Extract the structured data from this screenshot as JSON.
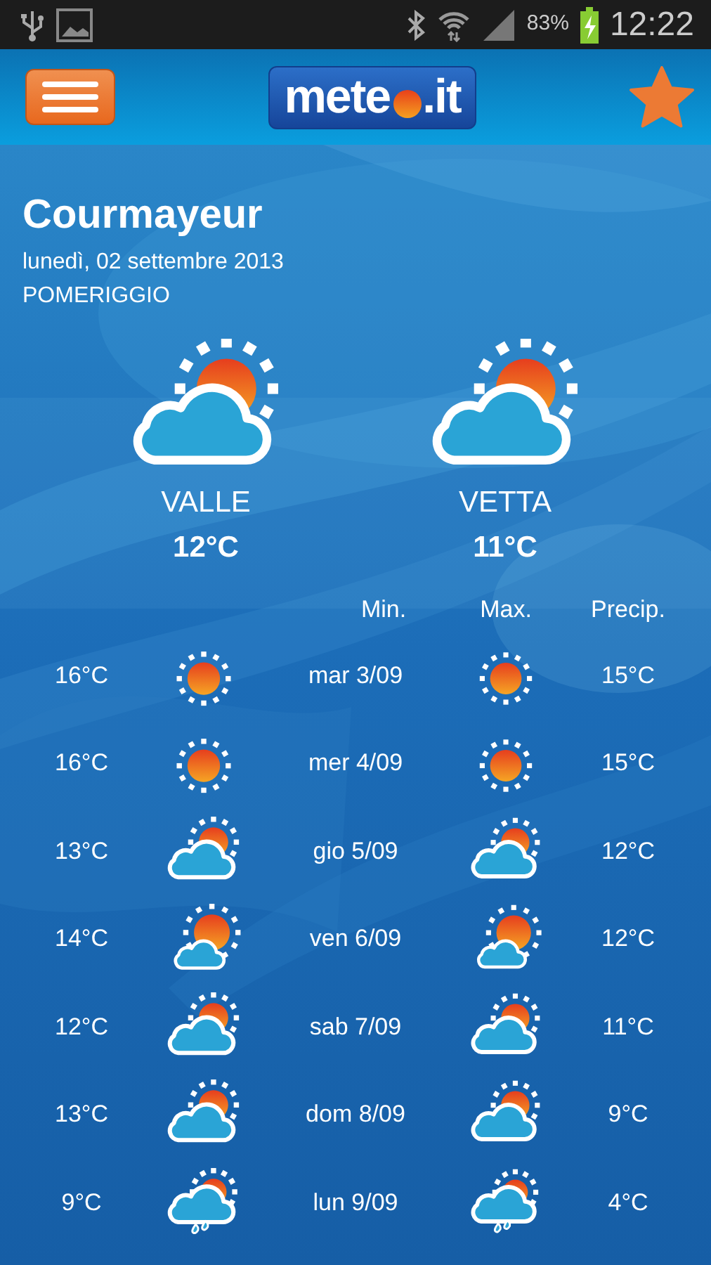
{
  "status_bar": {
    "battery": "83%",
    "time": "12:22"
  },
  "header": {
    "logo": {
      "before": "mete",
      "after": ".it"
    }
  },
  "location": {
    "name": "Courmayeur",
    "date": "lunedì, 02 settembre 2013",
    "period": "POMERIGGIO"
  },
  "current": [
    {
      "label": "VALLE",
      "temp": "12°C",
      "kind": "cloud_sun"
    },
    {
      "label": "VETTA",
      "temp": "11°C",
      "kind": "cloud_sun"
    }
  ],
  "forecast": {
    "columns": [
      "Min.",
      "Max.",
      "Precip."
    ],
    "rows": [
      {
        "temp_1": "16°C",
        "icon_1": {
          "kind": "sun"
        },
        "day": "mar 3/09",
        "icon_2": {
          "kind": "sun"
        },
        "temp_2": "15°C"
      },
      {
        "temp_1": "16°C",
        "icon_1": {
          "kind": "sun"
        },
        "day": "mer 4/09",
        "icon_2": {
          "kind": "sun"
        },
        "temp_2": "15°C"
      },
      {
        "temp_1": "13°C",
        "icon_1": {
          "kind": "cloud_sun"
        },
        "day": "gio 5/09",
        "icon_2": {
          "kind": "cloud_sun"
        },
        "temp_2": "12°C"
      },
      {
        "temp_1": "14°C",
        "icon_1": {
          "kind": "sun_cloud"
        },
        "day": "ven 6/09",
        "icon_2": {
          "kind": "sun_cloud"
        },
        "temp_2": "12°C"
      },
      {
        "temp_1": "12°C",
        "icon_1": {
          "kind": "cloud_sun"
        },
        "day": "sab 7/09",
        "icon_2": {
          "kind": "cloud_sun"
        },
        "temp_2": "11°C"
      },
      {
        "temp_1": "13°C",
        "icon_1": {
          "kind": "cloud_sun"
        },
        "day": "dom 8/09",
        "icon_2": {
          "kind": "cloud_sun"
        },
        "temp_2": "9°C"
      },
      {
        "temp_1": "9°C",
        "icon_1": {
          "kind": "rain"
        },
        "day": "lun 9/09",
        "icon_2": {
          "kind": "rain"
        },
        "temp_2": "4°C"
      }
    ]
  }
}
